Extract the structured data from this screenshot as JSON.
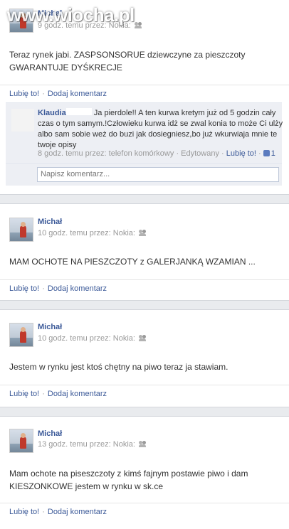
{
  "watermark": "www.wiocha.pl",
  "colors": {
    "link": "#3b5998",
    "meta": "#999999",
    "separator": "#e9ebee"
  },
  "post1": {
    "author": "Michał",
    "meta": "9 godz. temu przez: Nokia:",
    "text": "Teraz rynek jabi. ZASPSONSORUE dziewczyne za pieszczoty GWARANTUJE DYŚKRECJE",
    "actions": {
      "like": "Lubię to!",
      "comment": "Dodaj komentarz"
    },
    "comment": {
      "author": "Klaudia",
      "text": "Ja pierdole!! A ten kurwa kretym już od 5 godzin cały czas o tym samym.!Człowieku kurwa idż se zwal konia to może Ci ulży albo sam sobie weż do buzi jak dosiegniesz,bo już wkurwiaja mnie te twoje opisy",
      "meta_time": "8 godz. temu przez: telefon komórkowy",
      "meta_edited": "Edytowany",
      "meta_like": "Lubię to!",
      "like_count": "1"
    },
    "input_placeholder": "Napisz komentarz..."
  },
  "post2": {
    "author": "Michał",
    "meta": "10 godz. temu przez: Nokia:",
    "text": "MAM OCHOTE NA PIESZCZOTY z GALERJANKĄ WZAMIAN ...",
    "actions": {
      "like": "Lubię to!",
      "comment": "Dodaj komentarz"
    }
  },
  "post3": {
    "author": "Michał",
    "meta": "10 godz. temu przez: Nokia:",
    "text": "Jestem w rynku jest ktoś chętny na piwo teraz ja stawiam.",
    "actions": {
      "like": "Lubię to!",
      "comment": "Dodaj komentarz"
    }
  },
  "post4": {
    "author": "Michał",
    "meta": "13 godz. temu przez: Nokia:",
    "text": "Mam ochote na piseszczoty z kimś fajnym postawie piwo i dam KIESZONKOWE jestem w rynku w sk.ce",
    "actions": {
      "like": "Lubię to!",
      "comment": "Dodaj komentarz"
    }
  }
}
